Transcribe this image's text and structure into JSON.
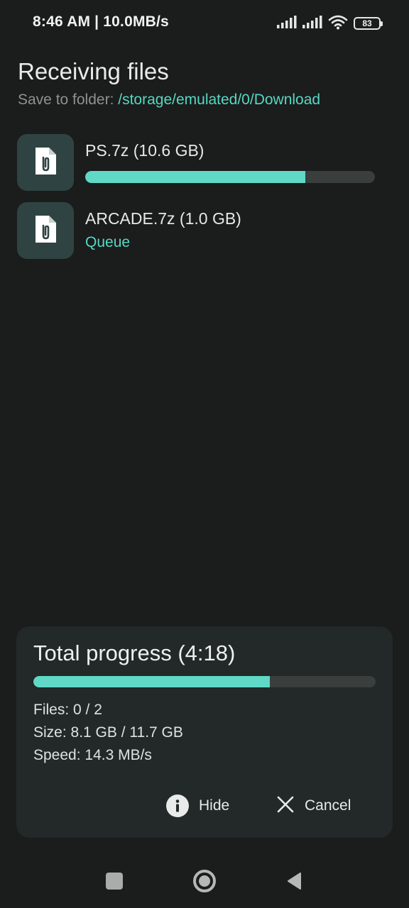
{
  "status_bar": {
    "time_speed": "8:46 AM | 10.0MB/s",
    "battery": "83",
    "icons": [
      "signal-icon",
      "signal-icon",
      "wifi-icon",
      "battery-icon"
    ]
  },
  "header": {
    "title": "Receiving files",
    "folder_label": "Save to folder: ",
    "folder_path": "/storage/emulated/0/Download"
  },
  "files": [
    {
      "name": "PS.7z (10.6 GB)",
      "progress": 0.76,
      "icon": "file-attachment-icon"
    },
    {
      "name": "ARCADE.7z (1.0 GB)",
      "status": "Queue",
      "icon": "file-attachment-icon"
    }
  ],
  "total": {
    "title": "Total progress (4:18)",
    "progress": 0.69,
    "files": "Files: 0 / 2",
    "size": "Size: 8.1 GB / 11.7 GB",
    "speed": "Speed: 14.3 MB/s"
  },
  "actions": {
    "hide_label": "Hide",
    "cancel_label": "Cancel"
  },
  "colors": {
    "accent": "#56d8c3",
    "background": "#1b1c1c",
    "card": "#222928",
    "icon_box": "#2f4442"
  },
  "nav": [
    "recents-icon",
    "home-icon",
    "back-icon"
  ]
}
